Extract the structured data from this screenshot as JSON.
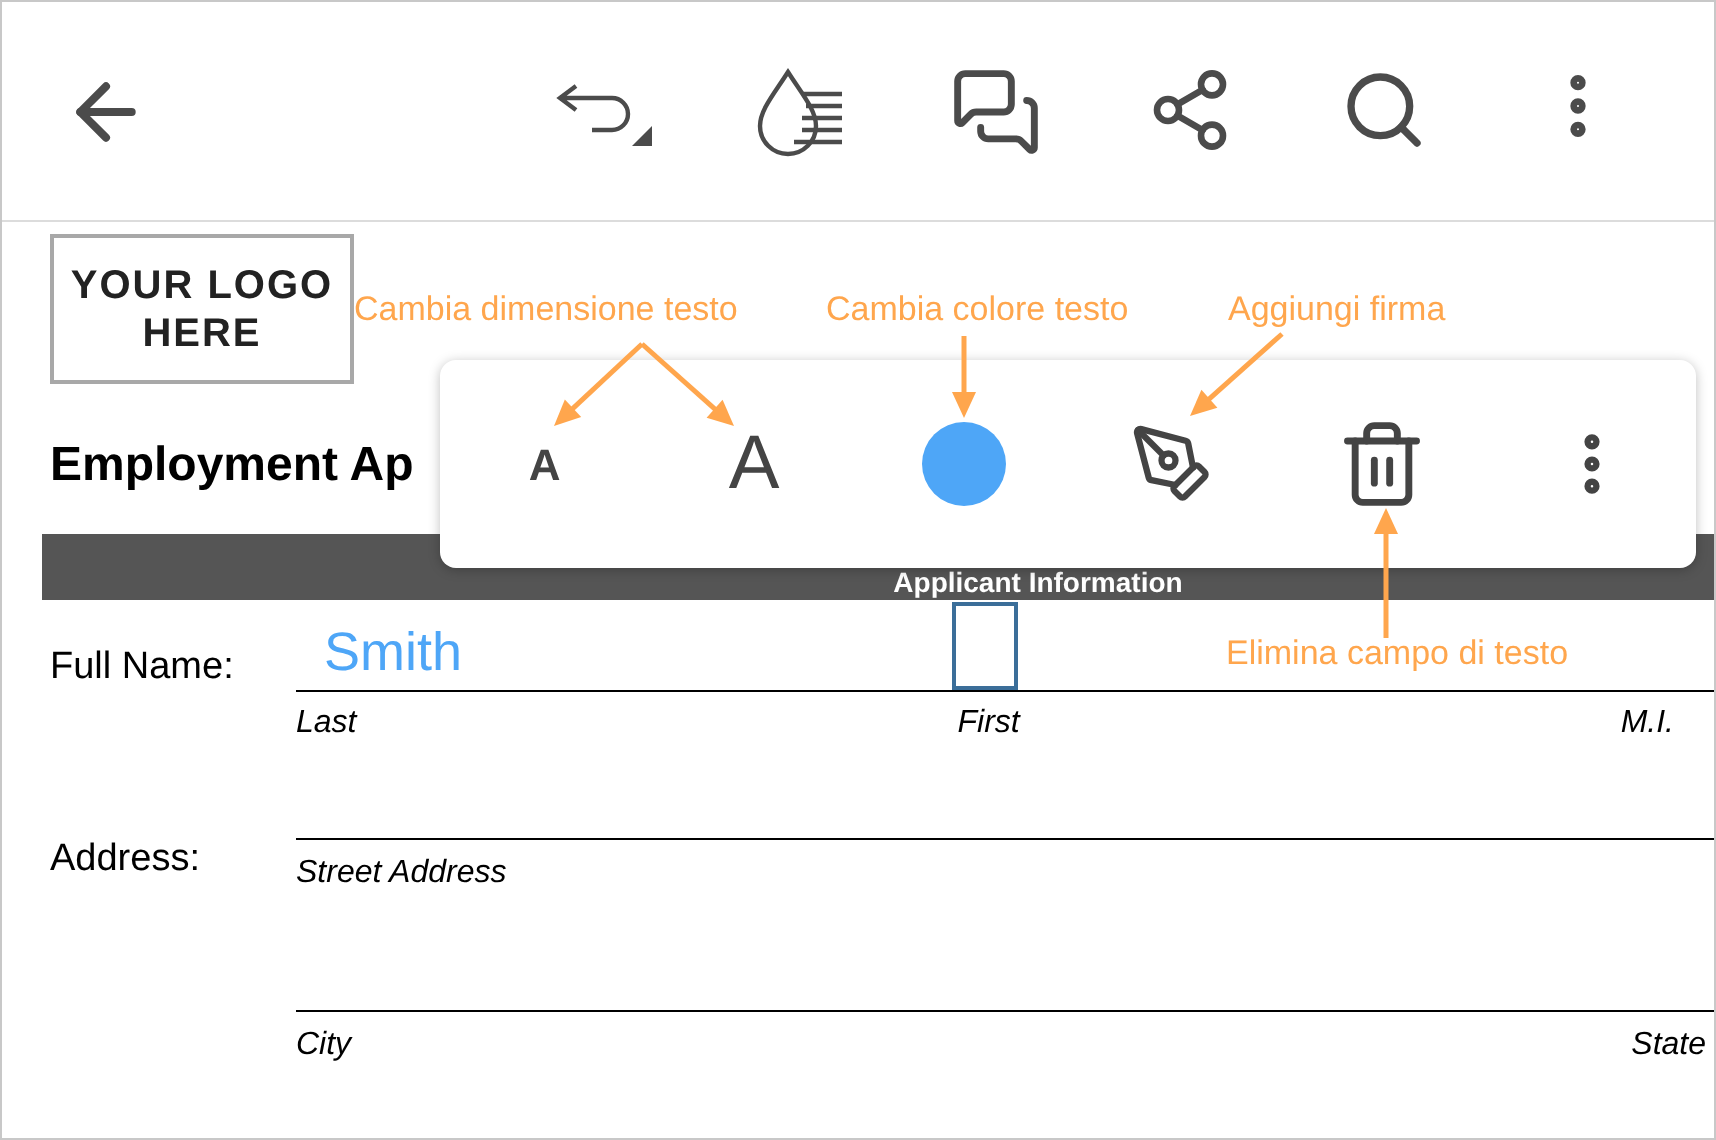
{
  "document": {
    "logo": "YOUR LOGO HERE",
    "title": "Employment Ap",
    "section_header": "Applicant Information",
    "full_name": {
      "label": "Full Name:",
      "value": "Smith",
      "sublabels": [
        "Last",
        "First",
        "M.I."
      ]
    },
    "address": {
      "label": "Address:",
      "lines": [
        {
          "sublabels": [
            "Street Address"
          ]
        },
        {
          "sublabels": [
            "City",
            "State"
          ]
        }
      ]
    }
  },
  "popup": {
    "size_buttons": [
      "A",
      "A"
    ]
  },
  "annotations": [
    {
      "text": "Cambia dimensione testo"
    },
    {
      "text": "Cambia colore testo"
    },
    {
      "text": "Aggiungi firma"
    },
    {
      "text": "Elimina campo di testo"
    }
  ]
}
